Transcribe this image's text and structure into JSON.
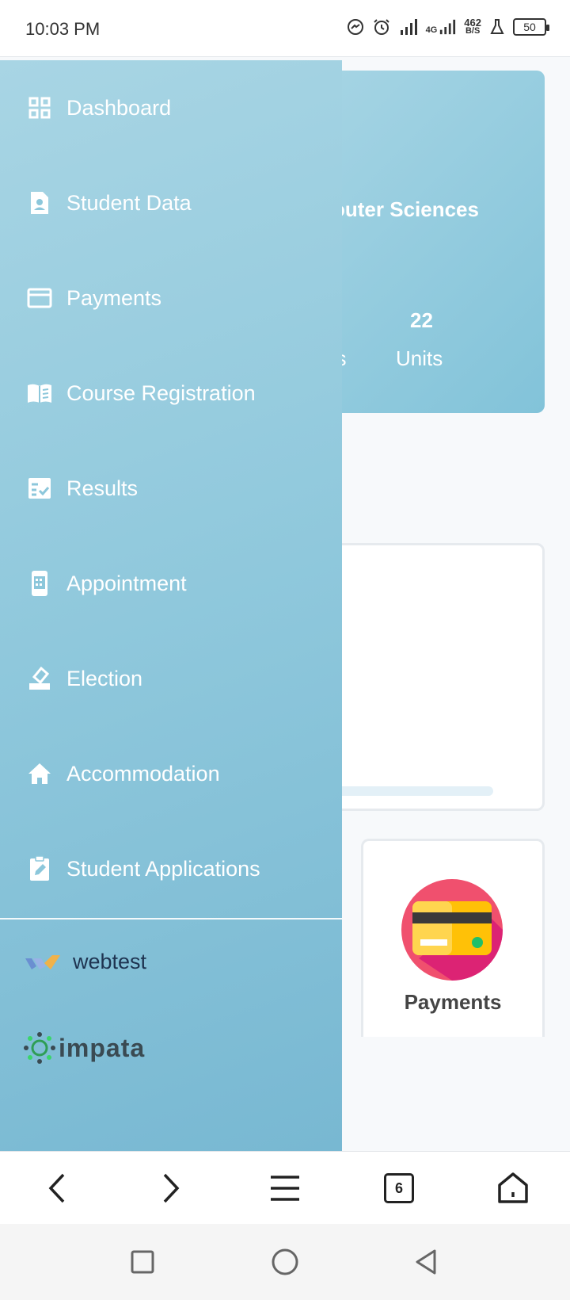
{
  "status_bar": {
    "time": "10:03 PM",
    "network_type": "4G",
    "net_speed_value": "462",
    "net_speed_unit": "B/S",
    "battery": "50",
    "icons": [
      "messenger-icon",
      "alarm-icon",
      "signal-icon",
      "signal-4g-icon",
      "lab-icon",
      "battery-icon"
    ]
  },
  "background_page": {
    "hero_department": "outer Sciences",
    "hero_stat_partial": "es",
    "hero_units_count": "22",
    "hero_units_label": "Units",
    "payments_card_label": "Payments"
  },
  "drawer": {
    "items": [
      {
        "label": "Dashboard",
        "icon": "dashboard-grid-icon"
      },
      {
        "label": "Student Data",
        "icon": "student-file-icon"
      },
      {
        "label": "Payments",
        "icon": "credit-card-icon"
      },
      {
        "label": "Course Registration",
        "icon": "open-book-icon"
      },
      {
        "label": "Results",
        "icon": "checklist-icon"
      },
      {
        "label": "Appointment",
        "icon": "phone-calendar-icon"
      },
      {
        "label": "Election",
        "icon": "ballot-icon"
      },
      {
        "label": "Accommodation",
        "icon": "home-icon"
      },
      {
        "label": "Student Applications",
        "icon": "clipboard-edit-icon"
      }
    ],
    "brands": {
      "webtest": "webtest",
      "impata": "impata"
    }
  },
  "browser_bar": {
    "tab_count": "6",
    "icons": [
      "back-arrow-icon",
      "forward-arrow-icon",
      "menu-icon",
      "tabs-icon",
      "home-icon"
    ]
  },
  "colors": {
    "drawer_gradient_start": "#a8d5e4",
    "drawer_gradient_end": "#78b8d2",
    "payments_circle": "#f0506e"
  }
}
